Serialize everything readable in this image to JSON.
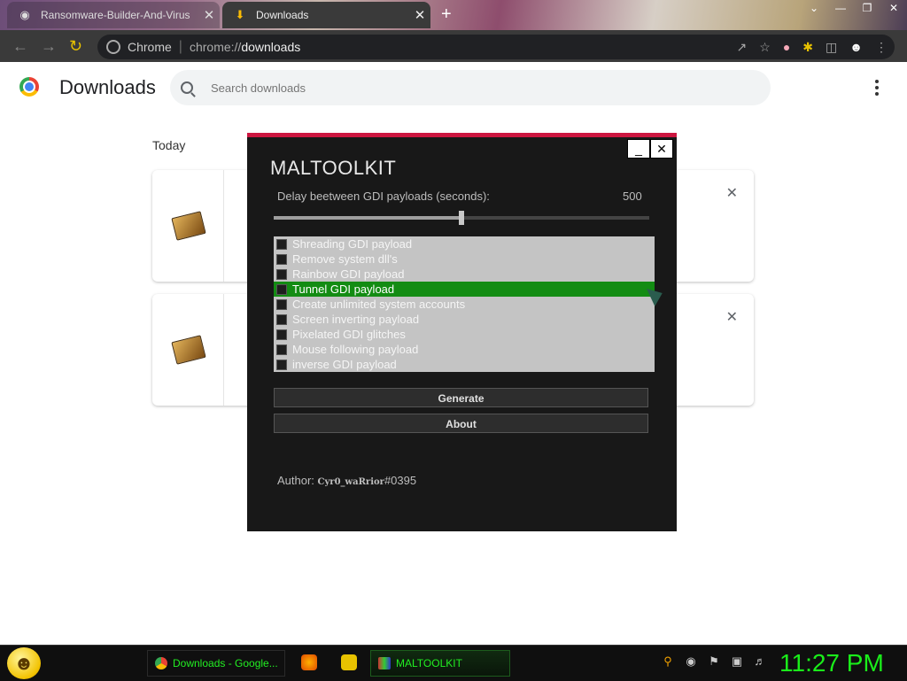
{
  "browser": {
    "tabs": [
      {
        "title": "Ransomware-Builder-And-Virus",
        "icon": "github-icon",
        "active": false
      },
      {
        "title": "Downloads",
        "icon": "download-icon",
        "active": true
      }
    ],
    "omnibox": {
      "site_label": "Chrome",
      "url_scheme": "chrome://",
      "url_path": "downloads"
    }
  },
  "downloads_page": {
    "title": "Downloads",
    "search_placeholder": "Search downloads",
    "section_label": "Today",
    "accent": "#4285f4"
  },
  "tool_window": {
    "title": "MALTOOLKIT",
    "accent_border": "#cc1640",
    "delay_label": "Delay beetween GDI payloads (seconds):",
    "delay_value": "500",
    "slider_fraction": 0.5,
    "payloads": [
      {
        "label": "Shreading GDI payload",
        "selected": false
      },
      {
        "label": "Remove system dll's",
        "selected": false
      },
      {
        "label": "Rainbow GDI payload",
        "selected": false
      },
      {
        "label": "Tunnel GDI payload",
        "selected": true
      },
      {
        "label": "Create unlimited system accounts",
        "selected": false
      },
      {
        "label": "Screen inverting payload",
        "selected": false
      },
      {
        "label": "Pixelated GDI glitches",
        "selected": false
      },
      {
        "label": "Mouse following payload",
        "selected": false
      },
      {
        "label": "inverse GDI payload",
        "selected": false
      }
    ],
    "selected_color": "#138c13",
    "generate_label": "Generate",
    "about_label": "About",
    "author_prefix": "Author: ",
    "author_handle": "Cyr0_waRrior",
    "author_tag": "#0395"
  },
  "taskbar": {
    "chrome_task_label": "Downloads - Google...",
    "maltoolkit_task_label": "MALTOOLKIT",
    "clock": "11:27 PM",
    "clock_color": "#1aee1a"
  }
}
